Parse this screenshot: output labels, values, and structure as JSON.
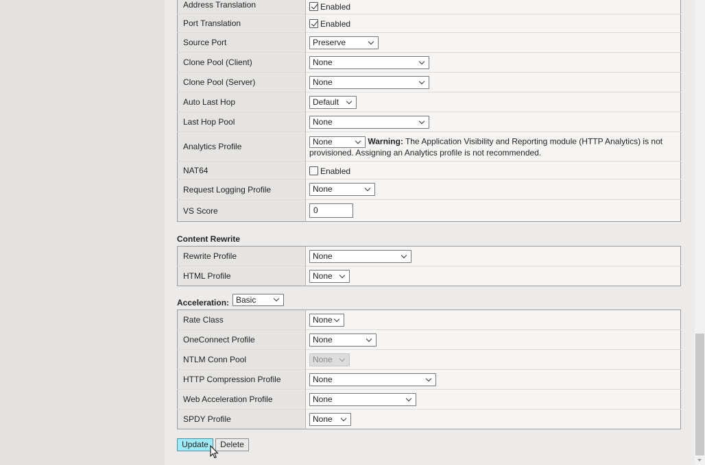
{
  "top_section": {
    "rows": [
      {
        "label": "Address Translation",
        "checkbox": "checked",
        "check_label": "Enabled"
      },
      {
        "label": "Port Translation",
        "checkbox": "checked",
        "check_label": "Enabled"
      },
      {
        "label": "Source Port",
        "select": "Preserve"
      },
      {
        "label": "Clone Pool (Client)",
        "select": "None"
      },
      {
        "label": "Clone Pool (Server)",
        "select": "None"
      },
      {
        "label": "Auto Last Hop",
        "select": "Default"
      },
      {
        "label": "Last Hop Pool",
        "select": "None"
      },
      {
        "label": "Analytics Profile",
        "select": "None",
        "warning_label": "Warning:",
        "warning_text": "The Application Visibility and Reporting module (HTTP Analytics) is not provisioned. Assigning an Analytics profile is not recommended."
      },
      {
        "label": "NAT64",
        "checkbox": "unchecked",
        "check_label": "Enabled"
      },
      {
        "label": "Request Logging Profile",
        "select": "None"
      },
      {
        "label": "VS Score",
        "input": "0"
      }
    ]
  },
  "content_rewrite": {
    "title": "Content Rewrite",
    "rows": [
      {
        "label": "Rewrite Profile",
        "select": "None"
      },
      {
        "label": "HTML Profile",
        "select": "None"
      }
    ]
  },
  "acceleration": {
    "title": "Acceleration:",
    "mode": "Basic",
    "rows": [
      {
        "label": "Rate Class",
        "select": "None"
      },
      {
        "label": "OneConnect Profile",
        "select": "None"
      },
      {
        "label": "NTLM Conn Pool",
        "select": "None",
        "disabled": true
      },
      {
        "label": "HTTP Compression Profile",
        "select": "None"
      },
      {
        "label": "Web Acceleration Profile",
        "select": "None"
      },
      {
        "label": "SPDY Profile",
        "select": "None"
      }
    ]
  },
  "buttons": {
    "update": "Update",
    "delete": "Delete"
  },
  "icons": {
    "cursor": "mouse-pointer-icon",
    "dropdown": "chevron-down-icon",
    "checkbox": "checkbox-icon"
  },
  "colors": {
    "update_button_bg": "#9feaf7",
    "label_col_bg": "#e5e4e2",
    "value_col_bg": "#f6f5f3"
  }
}
